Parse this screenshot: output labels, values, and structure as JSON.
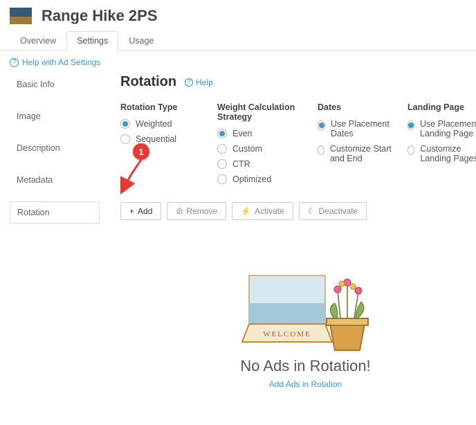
{
  "header": {
    "title": "Range Hike 2PS"
  },
  "tabs": [
    {
      "label": "Overview",
      "active": false
    },
    {
      "label": "Settings",
      "active": true
    },
    {
      "label": "Usage",
      "active": false
    }
  ],
  "help_link": {
    "label": "Help with Ad Settings"
  },
  "sidebar": {
    "items": [
      {
        "label": "Basic Info",
        "active": false
      },
      {
        "label": "Image",
        "active": false
      },
      {
        "label": "Description",
        "active": false
      },
      {
        "label": "Metadata",
        "active": false
      },
      {
        "label": "Rotation",
        "active": true
      }
    ]
  },
  "section": {
    "title": "Rotation",
    "help": "Help"
  },
  "rotation_type": {
    "title": "Rotation Type",
    "options": [
      {
        "label": "Weighted",
        "checked": true
      },
      {
        "label": "Sequential",
        "checked": false
      }
    ]
  },
  "weight_strategy": {
    "title": "Weight Calculation Strategy",
    "options": [
      {
        "label": "Even",
        "checked": true
      },
      {
        "label": "Custom",
        "checked": false
      },
      {
        "label": "CTR",
        "checked": false
      },
      {
        "label": "Optimized",
        "checked": false
      }
    ]
  },
  "dates": {
    "title": "Dates",
    "options": [
      {
        "label": "Use Placement Dates",
        "checked": true
      },
      {
        "label": "Customize Start and End",
        "checked": false
      }
    ]
  },
  "landing_page": {
    "title": "Landing Page",
    "options": [
      {
        "label": "Use Placement Landing Page",
        "checked": true
      },
      {
        "label": "Customize Landing Pages",
        "checked": false
      }
    ]
  },
  "toolbar": {
    "add": "Add",
    "remove": "Remove",
    "activate": "Activate",
    "deactivate": "Deactivate"
  },
  "annotation": {
    "badge": "1"
  },
  "empty_state": {
    "title": "No Ads in Rotation!",
    "link": "Add Ads in Rotation"
  }
}
